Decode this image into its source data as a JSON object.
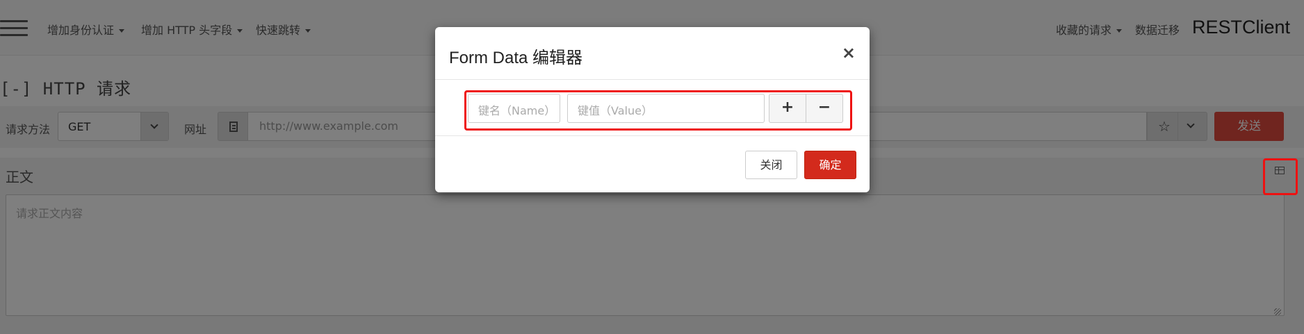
{
  "navbar": {
    "menu_items": [
      {
        "label": "增加身份认证"
      },
      {
        "label": "增加 HTTP 头字段"
      },
      {
        "label": "快速跳转"
      }
    ],
    "right_items": [
      {
        "label": "收藏的请求"
      },
      {
        "label": "数据迁移"
      }
    ],
    "brand": "RESTClient"
  },
  "request": {
    "section_title": "[-] HTTP 请求",
    "method_label": "请求方法",
    "method_value": "GET",
    "url_label": "网址",
    "url_placeholder": "http://www.example.com",
    "send_label": "发送"
  },
  "body": {
    "title": "正文",
    "placeholder": "请求正文内容",
    "table_icon": "table-icon"
  },
  "modal": {
    "title": "Form Data 编辑器",
    "close_glyph": "×",
    "name_placeholder": "键名（Name）",
    "value_placeholder": "键值（Value）",
    "add_glyph": "+",
    "remove_glyph": "−",
    "close_label": "关闭",
    "ok_label": "确定"
  },
  "colors": {
    "accent_red": "#d32a1c",
    "highlight": "#ee1111"
  }
}
